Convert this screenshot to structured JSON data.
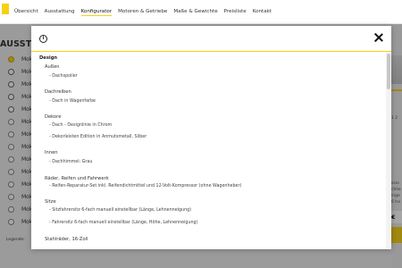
{
  "nav": {
    "items": [
      {
        "label": "Übersicht",
        "active": false
      },
      {
        "label": "Ausstattung",
        "active": false
      },
      {
        "label": "Konfigurator",
        "active": true
      },
      {
        "label": "Motoren & Getriebe",
        "active": false
      },
      {
        "label": "Maße & Gewichte",
        "active": false
      },
      {
        "label": "Preisliste",
        "active": false
      },
      {
        "label": "Kontakt",
        "active": false
      }
    ]
  },
  "background": {
    "title": "AUSSTATT",
    "rows": [
      {
        "label": "Mok",
        "state": "checked"
      },
      {
        "label": "Mok",
        "state": "empty"
      },
      {
        "label": "Mok",
        "state": "empty"
      },
      {
        "label": "Mok",
        "state": "empty"
      },
      {
        "label": "Mok",
        "state": "empty"
      },
      {
        "label": "Mok",
        "state": "info"
      },
      {
        "label": "Mok",
        "state": "info"
      },
      {
        "label": "Mok",
        "state": "info"
      },
      {
        "label": "Mok",
        "state": "info"
      },
      {
        "label": "Mok",
        "state": "info"
      },
      {
        "label": "Mok",
        "state": "info"
      },
      {
        "label": "Mok",
        "state": "info"
      },
      {
        "label": "Mok",
        "state": "info"
      },
      {
        "label": "Mok",
        "state": "info"
      }
    ],
    "legend": "Legende:",
    "right_texts": [
      "1 2",
      "ssio",
      "chlie",
      "inge",
      "6 ha"
    ],
    "price": "€ 20"
  },
  "modal": {
    "info_icon": "i",
    "section_title": "Design",
    "groups": [
      {
        "title": "Außen",
        "items": [
          "- Dachspoiler"
        ]
      },
      {
        "title": "Dachreiben",
        "items": [
          "- Dach in Wagenfarbe"
        ]
      },
      {
        "title": "Dekore",
        "items": [
          "- Dach - Designlinie in Chrom",
          "- Dekorleisten Edition in Anmutsmetall, Silber"
        ]
      },
      {
        "title": "Innen",
        "items": [
          "- Dachhimmel: Grau"
        ]
      },
      {
        "title": "Räder, Reifen und Fahrwerk",
        "items": [
          "- Reifen-Reparatur-Set inkl. Reifendichtmittel und 12-Volt-Kompressor (ohne Wagenheber)"
        ]
      },
      {
        "title": "Sitze",
        "items": [
          "- Sitzfahrersitz 6-fach manuell einstellbar (Länge, Lehnenneigung)",
          "- Fahrersitz 6-fach manuell einstellbar (Länge, Höhe, Lehnenneigung)"
        ]
      },
      {
        "title": "Stahlräder, 16-Zoll",
        "items": []
      }
    ]
  },
  "colors": {
    "accent": "#f7d117",
    "overlay": "rgba(0,0,0,0.35)"
  }
}
